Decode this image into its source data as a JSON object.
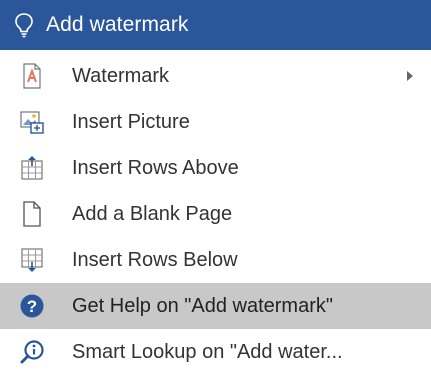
{
  "header": {
    "title": "Add watermark",
    "icon": "lightbulb-icon"
  },
  "items": [
    {
      "label": "Watermark",
      "icon": "watermark-icon",
      "has_submenu": true
    },
    {
      "label": "Insert Picture",
      "icon": "insert-picture-icon"
    },
    {
      "label": "Insert Rows Above",
      "icon": "insert-rows-above-icon"
    },
    {
      "label": "Add a Blank Page",
      "icon": "blank-page-icon"
    },
    {
      "label": "Insert Rows Below",
      "icon": "insert-rows-below-icon"
    },
    {
      "label": "Get Help on \"Add watermark\"",
      "icon": "help-icon",
      "highlighted": true
    },
    {
      "label": "Smart Lookup on \"Add water...",
      "icon": "smart-lookup-icon"
    }
  ],
  "colors": {
    "header_bg": "#2b579a",
    "highlight_bg": "#c8c8c8",
    "help_icon": "#2b579a",
    "watermark_icon": "#e07a5f"
  }
}
